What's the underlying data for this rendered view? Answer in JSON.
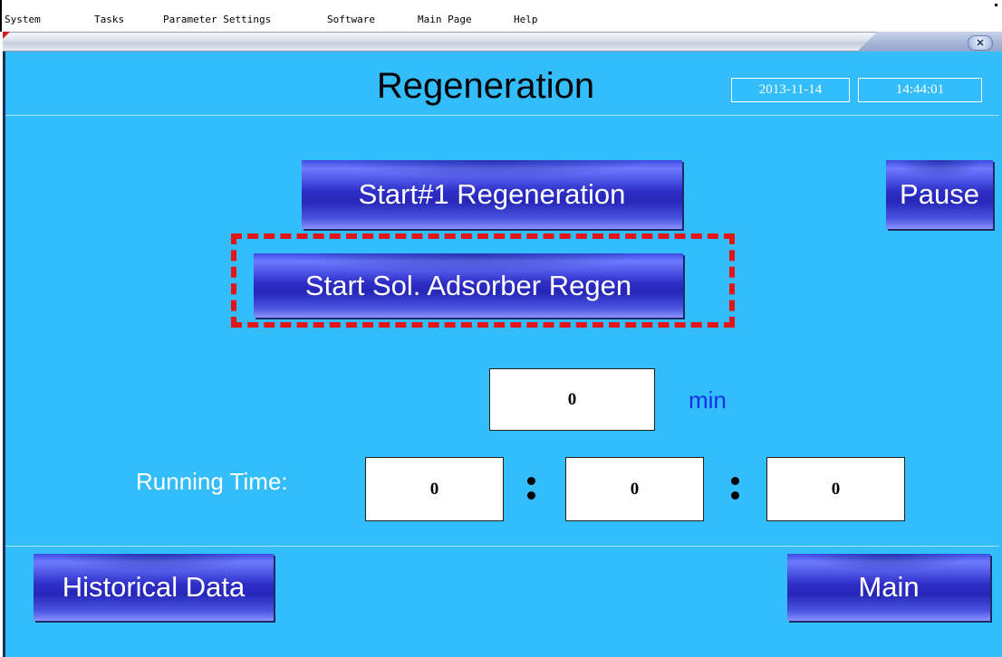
{
  "menu": [
    "System",
    "Tasks",
    "Parameter Settings",
    "Software",
    "Main Page",
    "Help"
  ],
  "window": {
    "close_symbol": "✕"
  },
  "header": {
    "title": "Regeneration",
    "date": "2013-11-14",
    "time": "14:44:01"
  },
  "buttons": {
    "start1": "Start#1 Regeneration",
    "pause": "Pause",
    "start_sol": "Start Sol. Adsorber Regen",
    "historical": "Historical Data",
    "main": "Main"
  },
  "timer": {
    "minutes_value": "0",
    "unit": "min"
  },
  "running_time": {
    "label": "Running Time:",
    "hours": "0",
    "minutes": "0",
    "seconds": "0"
  },
  "colors": {
    "panel_bg": "#33bdfc",
    "button": "#2f2fc8",
    "highlight": "#e3141a",
    "unit": "#1330e8"
  },
  "icons": {
    "close": "close-icon",
    "separator": "colon-separator-icon"
  }
}
